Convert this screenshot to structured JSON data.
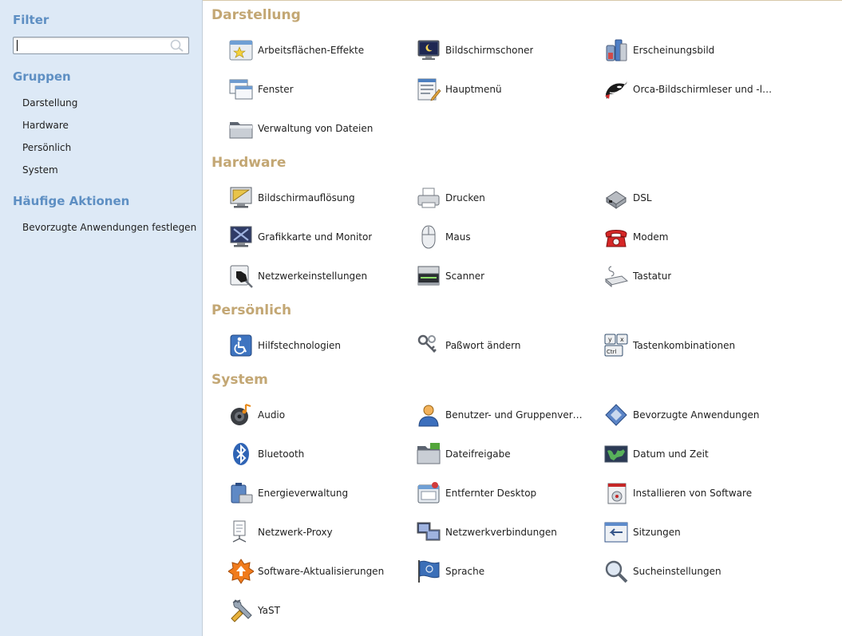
{
  "sidebar": {
    "filter_heading": "Filter",
    "search": {
      "value": "",
      "placeholder": ""
    },
    "groups_heading": "Gruppen",
    "groups": [
      "Darstellung",
      "Hardware",
      "Persönlich",
      "System"
    ],
    "actions_heading": "Häufige Aktionen",
    "actions": [
      "Bevorzugte Anwendungen festlegen"
    ]
  },
  "sections": [
    {
      "title": "Darstellung",
      "items": [
        {
          "label": "Arbeitsflächen-Effekte",
          "icon": "desktop-effects-icon"
        },
        {
          "label": "Bildschirmschoner",
          "icon": "screensaver-icon"
        },
        {
          "label": "Erscheinungsbild",
          "icon": "appearance-icon"
        },
        {
          "label": "Fenster",
          "icon": "window-icon"
        },
        {
          "label": "Hauptmenü",
          "icon": "main-menu-icon"
        },
        {
          "label": "Orca-Bildschirmleser und -lupe",
          "icon": "orca-icon"
        },
        {
          "label": "Verwaltung von Dateien",
          "icon": "folder-icon"
        }
      ]
    },
    {
      "title": "Hardware",
      "items": [
        {
          "label": "Bildschirmauflösung",
          "icon": "display-resolution-icon"
        },
        {
          "label": "Drucken",
          "icon": "printer-icon"
        },
        {
          "label": "DSL",
          "icon": "dsl-modem-icon"
        },
        {
          "label": "Grafikkarte und Monitor",
          "icon": "monitor-icon"
        },
        {
          "label": "Maus",
          "icon": "mouse-icon"
        },
        {
          "label": "Modem",
          "icon": "telephone-icon"
        },
        {
          "label": "Netzwerkeinstellungen",
          "icon": "network-settings-icon"
        },
        {
          "label": "Scanner",
          "icon": "scanner-icon"
        },
        {
          "label": "Tastatur",
          "icon": "keyboard-icon"
        }
      ]
    },
    {
      "title": "Persönlich",
      "items": [
        {
          "label": "Hilfstechnologien",
          "icon": "accessibility-icon"
        },
        {
          "label": "Paßwort ändern",
          "icon": "keys-icon"
        },
        {
          "label": "Tastenkombinationen",
          "icon": "keyboard-shortcuts-icon"
        }
      ]
    },
    {
      "title": "System",
      "items": [
        {
          "label": "Audio",
          "icon": "audio-speaker-icon"
        },
        {
          "label": "Benutzer- und Gruppenverwaltung",
          "display": "Benutzer- und Gruppenverwa…",
          "icon": "user-icon"
        },
        {
          "label": "Bevorzugte Anwendungen",
          "icon": "preferred-apps-icon"
        },
        {
          "label": "Bluetooth",
          "icon": "bluetooth-icon"
        },
        {
          "label": "Dateifreigabe",
          "icon": "file-sharing-icon"
        },
        {
          "label": "Datum und Zeit",
          "icon": "date-time-icon"
        },
        {
          "label": "Energieverwaltung",
          "icon": "power-management-icon"
        },
        {
          "label": "Entfernter Desktop",
          "icon": "remote-desktop-icon"
        },
        {
          "label": "Installieren von Software",
          "icon": "install-software-icon"
        },
        {
          "label": "Netzwerk-Proxy",
          "icon": "network-proxy-icon"
        },
        {
          "label": "Netzwerkverbindungen",
          "icon": "network-connections-icon"
        },
        {
          "label": "Sitzungen",
          "icon": "sessions-icon"
        },
        {
          "label": "Software-Aktualisierungen",
          "icon": "software-update-icon"
        },
        {
          "label": "Sprache",
          "icon": "language-flag-icon"
        },
        {
          "label": "Sucheinstellungen",
          "icon": "search-settings-icon"
        },
        {
          "label": "YaST",
          "icon": "yast-icon"
        }
      ]
    }
  ]
}
